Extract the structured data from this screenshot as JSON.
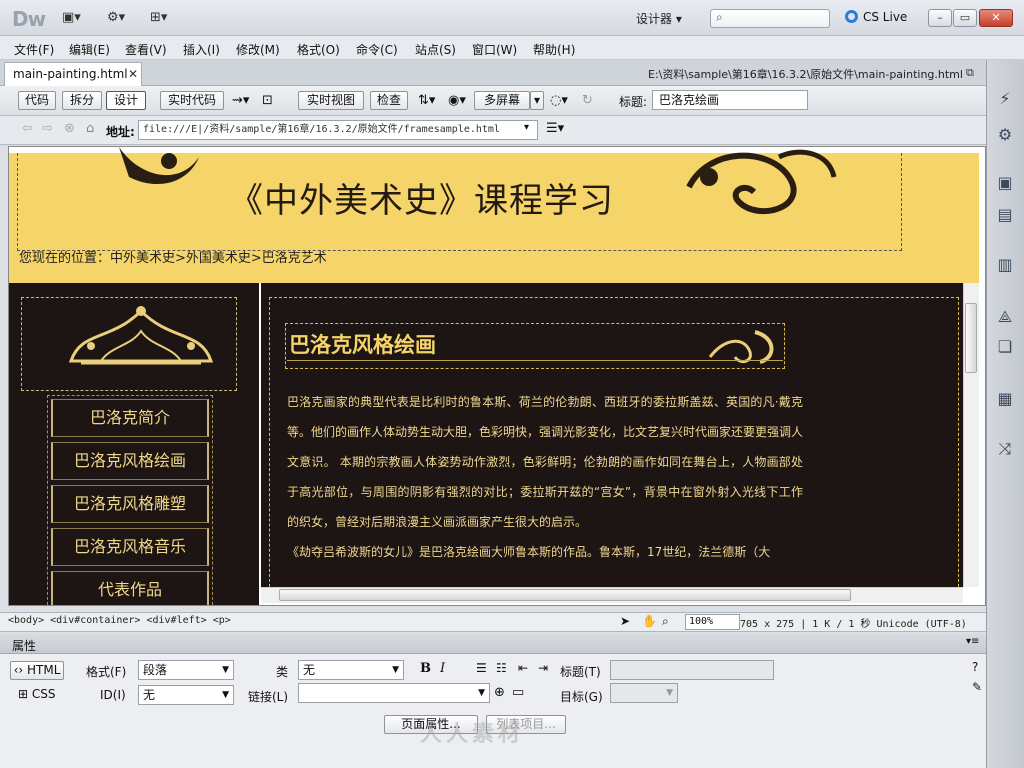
{
  "app": {
    "logo": "Dw",
    "workspace": "设计器",
    "cs_live": "CS Live"
  },
  "menu": [
    "文件(F)",
    "编辑(E)",
    "查看(V)",
    "插入(I)",
    "修改(M)",
    "格式(O)",
    "命令(C)",
    "站点(S)",
    "窗口(W)",
    "帮助(H)"
  ],
  "document": {
    "tab_label": "main-painting.html",
    "file_path": "E:\\资料\\sample\\第16章\\16.3.2\\原始文件\\main-painting.html"
  },
  "toolbar": {
    "code": "代码",
    "split": "拆分",
    "design": "设计",
    "live_code": "实时代码",
    "live_view": "实时视图",
    "inspect": "检查",
    "multiscreen": "多屏幕",
    "title_label": "标题:",
    "title_value": "巴洛克绘画"
  },
  "address": {
    "label": "地址:",
    "value": "file:///E|/资料/sample/第16章/16.3.2/原始文件/framesample.html"
  },
  "page": {
    "site_title": "《中外美术史》课程学习",
    "breadcrumb": "您现在的位置：中外美术史>外国美术史>巴洛克艺术",
    "nav": [
      "巴洛克简介",
      "巴洛克风格绘画",
      "巴洛克风格雕塑",
      "巴洛克风格音乐",
      "代表作品"
    ],
    "article_title": "巴洛克风格绘画",
    "article_p1": "巴洛克画家的典型代表是比利时的鲁本斯、荷兰的伦勃朗、西班牙的委拉斯盖兹、英国的凡·戴克等。他们的画作人体动势生动大胆，色彩明快，强调光影变化，比文艺复兴时代画家还要更强调人文意识。 本期的宗教画人体姿势动作激烈，色彩鲜明；伦勃朗的画作如同在舞台上，人物画部处于高光部位，与周围的阴影有强烈的对比；委拉斯开兹的“宫女”，背景中在窗外射入光线下工作的织女，曾经对后期浪漫主义画派画家产生很大的启示。",
    "article_p2": "《劫夺吕希波斯的女儿》是巴洛克绘画大师鲁本斯的作品。鲁本斯，17世纪，法兰德斯（大"
  },
  "status": {
    "tag_path": "<body> <div#container> <div#left> <p>",
    "zoom": "100%",
    "size": "705 x 275",
    "weight": "1 K / 1 秒",
    "encoding": "Unicode (UTF-8)"
  },
  "properties": {
    "header": "属性",
    "html_btn": "HTML",
    "css_btn": "CSS",
    "format_label": "格式(F)",
    "format_value": "段落",
    "class_label": "类",
    "class_value": "无",
    "id_label": "ID(I)",
    "id_value": "无",
    "link_label": "链接(L)",
    "title_label": "标题(T)",
    "target_label": "目标(G)",
    "page_props": "页面属性...",
    "list_item": "列表项目..."
  },
  "watermark": "人人素材",
  "colors": {
    "header_bg": "#f5d46a",
    "content_bg": "#1d1514",
    "gold_text": "#f0d889",
    "accent_blue": "#2b7bd8"
  }
}
